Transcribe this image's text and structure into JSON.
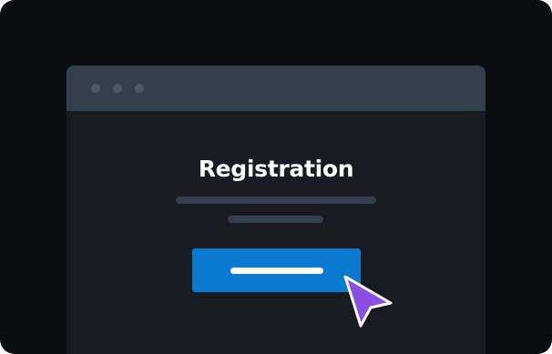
{
  "page": {
    "title": "Registration",
    "button_label_placeholder": "",
    "colors": {
      "background": "#0a0c10",
      "window": "#181c22",
      "titlebar": "#343d4a",
      "window_dots": "#4d5868",
      "placeholder_lines": "#343f4e",
      "button": "#0a7ad1",
      "cursor": "#8a4fe0"
    }
  },
  "icons": {
    "window_controls": [
      "window-dot-icon",
      "window-dot-icon",
      "window-dot-icon"
    ],
    "pointer": "cursor-arrow-icon"
  }
}
